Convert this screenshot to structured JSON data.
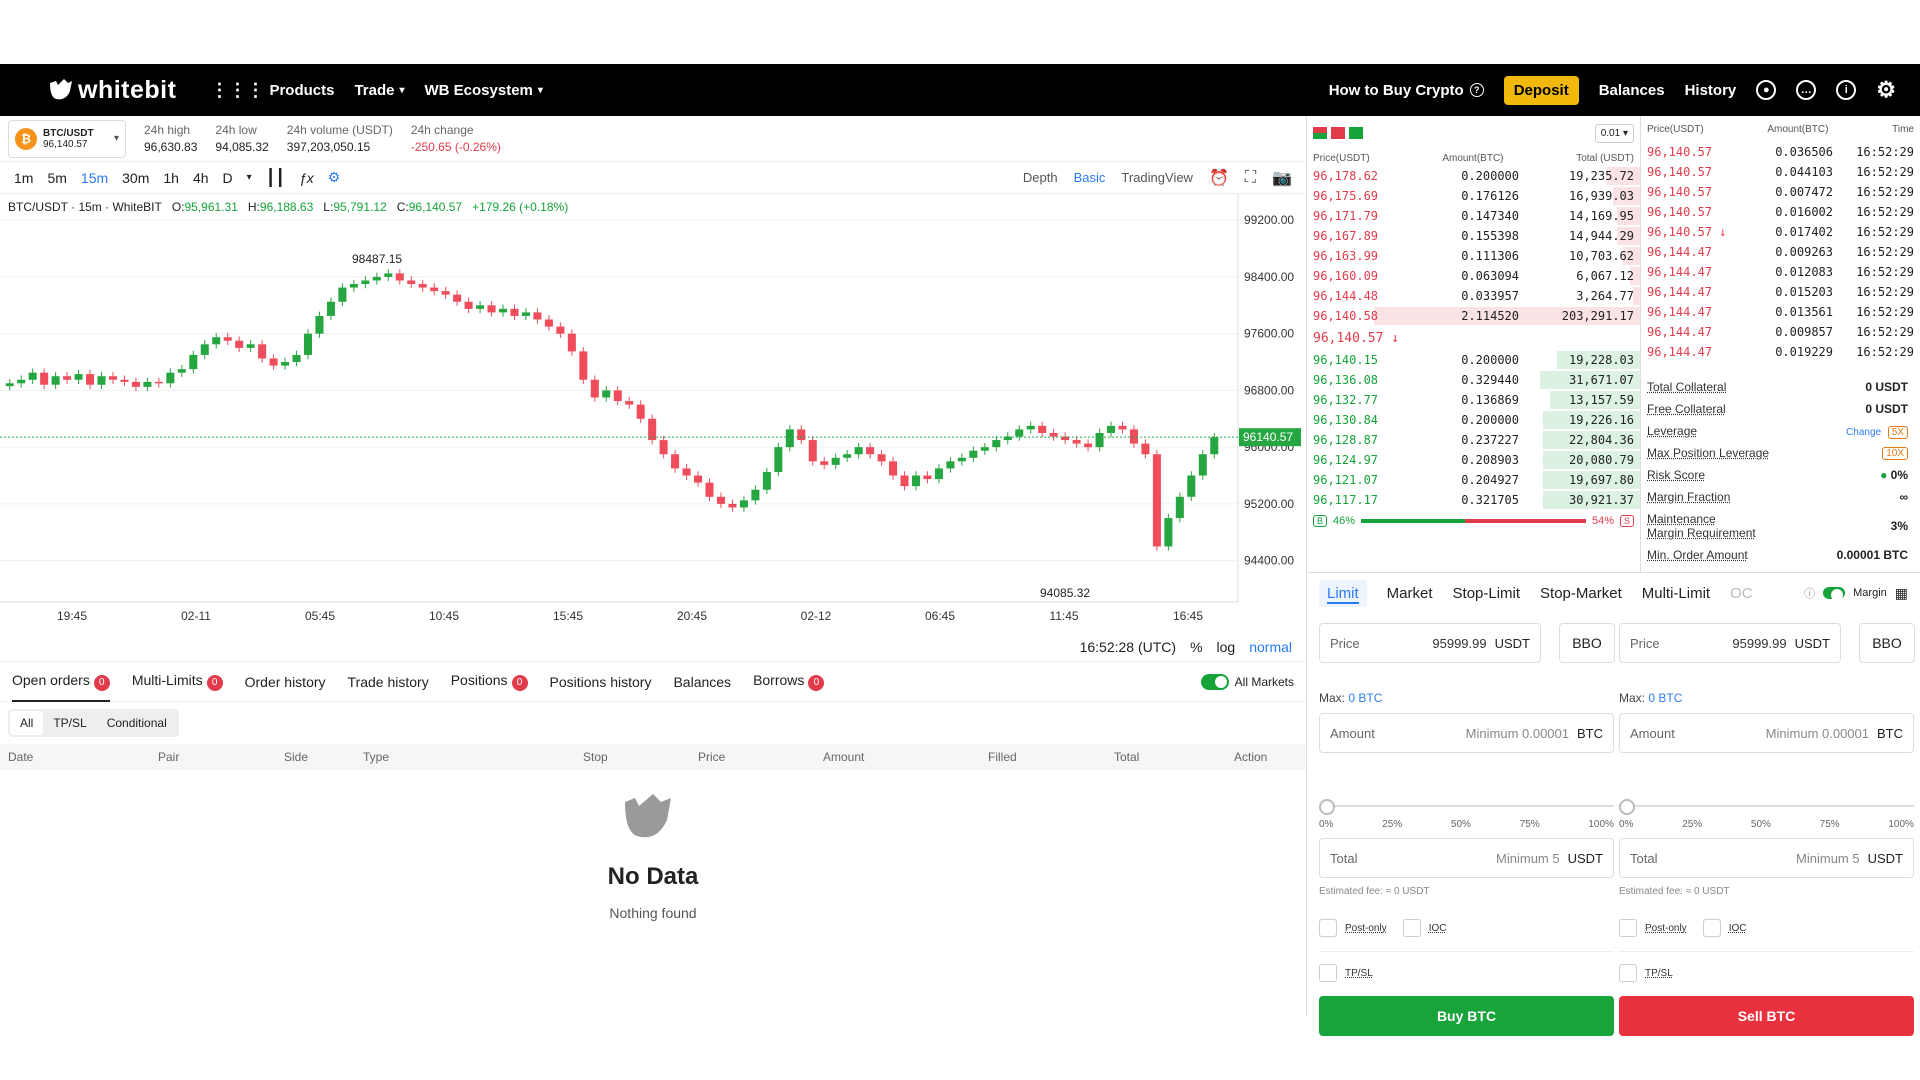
{
  "nav": {
    "brand": "whitebit",
    "products": "Products",
    "trade": "Trade",
    "ecosystem": "WB Ecosystem",
    "how_to_buy": "How to Buy Crypto",
    "deposit": "Deposit",
    "balances": "Balances",
    "history": "History"
  },
  "ticker": {
    "pair": "BTC/USDT",
    "price": "96,140.57",
    "high_label": "24h high",
    "high": "96,630.83",
    "low_label": "24h low",
    "low": "94,085.32",
    "vol_label": "24h volume (USDT)",
    "vol": "397,203,050.15",
    "chg_label": "24h change",
    "chg": "-250.65 (-0.26%)"
  },
  "chart_toolbar": {
    "intervals": [
      "1m",
      "5m",
      "15m",
      "30m",
      "1h",
      "4h",
      "D"
    ],
    "selected": "15m",
    "views": [
      "Depth",
      "Basic",
      "TradingView"
    ],
    "selected_view": "Basic"
  },
  "chart_info": {
    "symbol": "BTC/USDT · 15m · WhiteBIT",
    "o_label": "O:",
    "o": "95,961.31",
    "h_label": "H:",
    "h": "96,188.63",
    "l_label": "L:",
    "l": "95,791.12",
    "c_label": "C:",
    "c": "96,140.57",
    "change": "+179.26 (+0.18%)"
  },
  "chart_data": {
    "type": "candlestick",
    "y_ticks": [
      "99200.00",
      "98400.00",
      "97600.00",
      "96800.00",
      "96000.00",
      "95200.00",
      "94400.00"
    ],
    "ylim": [
      94000,
      99400
    ],
    "x_ticks": [
      "19:45",
      "02-11",
      "05:45",
      "10:45",
      "15:45",
      "20:45",
      "02-12",
      "06:45",
      "11:45",
      "16:45"
    ],
    "last_price": "96140.57",
    "max_label": "98487.15",
    "min_label": "94085.32",
    "close_series": [
      96900,
      96950,
      97050,
      96880,
      97000,
      96950,
      97030,
      96880,
      97000,
      96950,
      96920,
      96850,
      96920,
      96900,
      97050,
      97100,
      97300,
      97450,
      97550,
      97500,
      97400,
      97450,
      97250,
      97150,
      97200,
      97300,
      97600,
      97850,
      98050,
      98250,
      98300,
      98350,
      98400,
      98450,
      98350,
      98300,
      98250,
      98200,
      98150,
      98050,
      97950,
      98000,
      97900,
      97950,
      97850,
      97900,
      97800,
      97700,
      97600,
      97350,
      96950,
      96700,
      96800,
      96650,
      96600,
      96400,
      96100,
      95900,
      95700,
      95600,
      95500,
      95300,
      95200,
      95150,
      95250,
      95400,
      95650,
      96000,
      96250,
      96100,
      95800,
      95750,
      95850,
      95900,
      96000,
      95900,
      95800,
      95600,
      95450,
      95600,
      95550,
      95700,
      95800,
      95850,
      95950,
      96000,
      96100,
      96150,
      96250,
      96300,
      96200,
      96150,
      96100,
      96050,
      96000,
      96200,
      96300,
      96250,
      96050,
      95900,
      94600,
      95000,
      95300,
      95600,
      95900,
      96140
    ]
  },
  "chart_footer": {
    "time": "16:52:28 (UTC)",
    "pct": "%",
    "log": "log",
    "normal": "normal"
  },
  "bottom_tabs": {
    "tabs": [
      {
        "label": "Open orders",
        "count": "0"
      },
      {
        "label": "Multi-Limits",
        "count": "0"
      },
      {
        "label": "Order history",
        "count": ""
      },
      {
        "label": "Trade history",
        "count": ""
      },
      {
        "label": "Positions",
        "count": "0"
      },
      {
        "label": "Positions history",
        "count": ""
      },
      {
        "label": "Balances",
        "count": ""
      },
      {
        "label": "Borrows",
        "count": "0"
      }
    ],
    "all_markets": "All Markets",
    "filters": [
      "All",
      "TP/SL",
      "Conditional"
    ],
    "columns": [
      "Date",
      "Pair",
      "Side",
      "Type",
      "Stop",
      "Price",
      "Amount",
      "Filled",
      "Total",
      "Action"
    ],
    "empty_title": "No Data",
    "empty_sub": "Nothing found"
  },
  "orderbook": {
    "step": "0.01",
    "cols": [
      "Price(USDT)",
      "Amount(BTC)",
      "Total (USDT)"
    ],
    "asks": [
      {
        "p": "96,178.62",
        "a": "0.200000",
        "t": "19,235.72",
        "d": 0.1
      },
      {
        "p": "96,175.69",
        "a": "0.176126",
        "t": "16,939.03",
        "d": 0.08
      },
      {
        "p": "96,171.79",
        "a": "0.147340",
        "t": "14,169.95",
        "d": 0.07
      },
      {
        "p": "96,167.89",
        "a": "0.155398",
        "t": "14,944.29",
        "d": 0.07
      },
      {
        "p": "96,163.99",
        "a": "0.111306",
        "t": "10,703.62",
        "d": 0.05
      },
      {
        "p": "96,160.09",
        "a": "0.063094",
        "t": "6,067.12",
        "d": 0.03
      },
      {
        "p": "96,144.48",
        "a": "0.033957",
        "t": "3,264.77",
        "d": 0.02
      },
      {
        "p": "96,140.58",
        "a": "2.114520",
        "t": "203,291.17",
        "d": 0.8
      }
    ],
    "last": "96,140.57",
    "bids": [
      {
        "p": "96,140.15",
        "a": "0.200000",
        "t": "19,228.03",
        "d": 0.25
      },
      {
        "p": "96,136.08",
        "a": "0.329440",
        "t": "31,671.07",
        "d": 0.3
      },
      {
        "p": "96,132.77",
        "a": "0.136869",
        "t": "13,157.59",
        "d": 0.27
      },
      {
        "p": "96,130.84",
        "a": "0.200000",
        "t": "19,226.16",
        "d": 0.29
      },
      {
        "p": "96,128.87",
        "a": "0.237227",
        "t": "22,804.36",
        "d": 0.29
      },
      {
        "p": "96,124.97",
        "a": "0.208903",
        "t": "20,080.79",
        "d": 0.29
      },
      {
        "p": "96,121.07",
        "a": "0.204927",
        "t": "19,697.80",
        "d": 0.29
      },
      {
        "p": "96,117.17",
        "a": "0.321705",
        "t": "30,921.37",
        "d": 0.29
      }
    ],
    "buy_pct": "46%",
    "sell_pct": "54%",
    "buy_letter": "B",
    "sell_letter": "S"
  },
  "trades": {
    "cols": [
      "Price(USDT)",
      "Amount(BTC)",
      "Time"
    ],
    "rows": [
      {
        "p": "96,140.57",
        "a": "0.036506",
        "t": "16:52:29"
      },
      {
        "p": "96,140.57",
        "a": "0.044103",
        "t": "16:52:29"
      },
      {
        "p": "96,140.57",
        "a": "0.007472",
        "t": "16:52:29"
      },
      {
        "p": "96,140.57",
        "a": "0.016002",
        "t": "16:52:29"
      },
      {
        "p": "96,140.57 ↓",
        "a": "0.017402",
        "t": "16:52:29"
      },
      {
        "p": "96,144.47",
        "a": "0.009263",
        "t": "16:52:29"
      },
      {
        "p": "96,144.47",
        "a": "0.012083",
        "t": "16:52:29"
      },
      {
        "p": "96,144.47",
        "a": "0.015203",
        "t": "16:52:29"
      },
      {
        "p": "96,144.47",
        "a": "0.013561",
        "t": "16:52:29"
      },
      {
        "p": "96,144.47",
        "a": "0.009857",
        "t": "16:52:29"
      },
      {
        "p": "96,144.47",
        "a": "0.019229",
        "t": "16:52:29"
      }
    ]
  },
  "margin": {
    "total_collateral": "Total Collateral",
    "total_collateral_v": "0 USDT",
    "free_collateral": "Free Collateral",
    "free_collateral_v": "0 USDT",
    "leverage": "Leverage",
    "change": "Change",
    "leverage_v": "5X",
    "max_lev": "Max Position Leverage",
    "max_lev_v": "10X",
    "risk": "Risk Score",
    "risk_v": "0%",
    "margin_fraction": "Margin Fraction",
    "margin_fraction_v": "∞",
    "maintenance": "Maintenance",
    "maintenance2": "Margin Requirement",
    "maintenance_v": "3%",
    "min_order": "Min. Order Amount",
    "min_order_v": "0.00001 BTC"
  },
  "form": {
    "tabs": [
      "Limit",
      "Market",
      "Stop-Limit",
      "Stop-Market",
      "Multi-Limit",
      "OC"
    ],
    "margin_label": "Margin",
    "price_label": "Price",
    "price": "95999.99",
    "usdt": "USDT",
    "bbo": "BBO",
    "max_label": "Max:",
    "max": "0 BTC",
    "amount_label": "Amount",
    "amount_ph": "Minimum 0.00001",
    "btc": "BTC",
    "ticks": [
      "0%",
      "25%",
      "50%",
      "75%",
      "100%"
    ],
    "total_label": "Total",
    "total_ph": "Minimum 5",
    "fee": "Estimated fee: ≈ 0 USDT",
    "post_only": "Post-only",
    "ioc": "IOC",
    "tpsl": "TP/SL",
    "buy": "Buy BTC",
    "sell": "Sell BTC",
    "buy_color": "#18a33b",
    "sell_color": "#e8313f"
  }
}
